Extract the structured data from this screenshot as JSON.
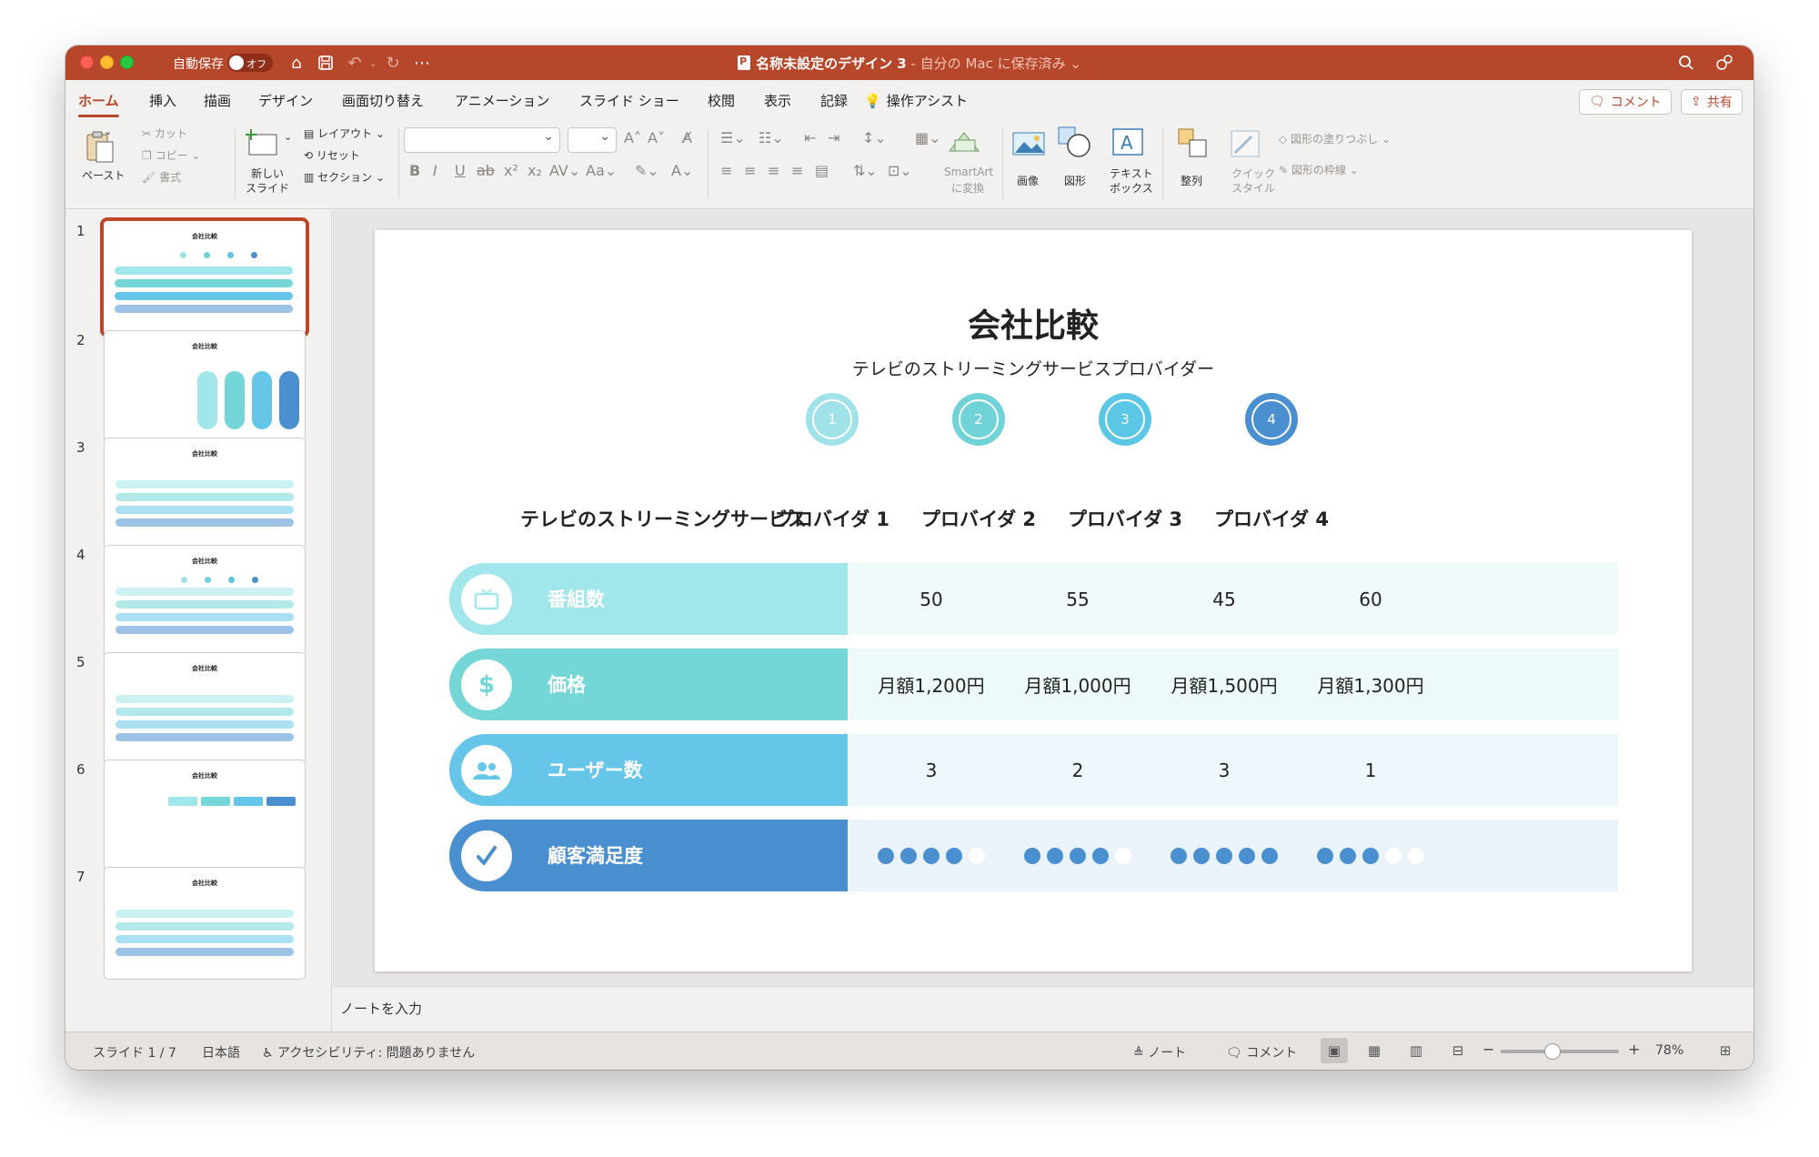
{
  "titlebar": {
    "autosave_label": "自動保存",
    "autosave_state": "オフ",
    "doc_title": "名称未設定のデザイン 3",
    "save_status": " - 自分の Mac に保存済み ⌄"
  },
  "tabs": [
    "ホーム",
    "挿入",
    "描画",
    "デザイン",
    "画面切り替え",
    "アニメーション",
    "スライド ショー",
    "校閲",
    "表示",
    "記録"
  ],
  "assist_label": "操作アシスト",
  "comment_button": "コメント",
  "share_button": "共有",
  "ribbon": {
    "paste": "ペースト",
    "cut": "カット",
    "copy": "コピー",
    "format": "書式",
    "new_slide_1": "新しい",
    "new_slide_2": "スライド",
    "layout": "レイアウト",
    "reset": "リセット",
    "section": "セクション",
    "smartart_1": "SmartArt",
    "smartart_2": "に変換",
    "picture": "画像",
    "shapes": "図形",
    "textbox_1": "テキスト",
    "textbox_2": "ボックス",
    "arrange": "整列",
    "quick_style_1": "クイック",
    "quick_style_2": "スタイル",
    "shape_fill": "図形の塗りつぶし",
    "shape_outline": "図形の枠線"
  },
  "thumbnails": {
    "numbers": [
      "1",
      "2",
      "3",
      "4",
      "5",
      "6",
      "7"
    ],
    "mini_title": "会社比較"
  },
  "slide": {
    "title": "会社比較",
    "subtitle": "テレビのストリーミングサービスプロバイダー",
    "row_header": "テレビのストリーミングサービス",
    "providers": [
      "プロバイダ 1",
      "プロバイダ 2",
      "プロバイダ 3",
      "プロバイダ 4"
    ],
    "provider_numbers": [
      "1",
      "2",
      "3",
      "4"
    ],
    "rows": [
      {
        "label": "番組数",
        "icon": "tv-icon",
        "values": [
          "50",
          "55",
          "45",
          "60"
        ]
      },
      {
        "label": "価格",
        "icon": "dollar-icon",
        "values": [
          "月額1,200円",
          "月額1,000円",
          "月額1,500円",
          "月額1,300円"
        ]
      },
      {
        "label": "ユーザー数",
        "icon": "users-icon",
        "values": [
          "3",
          "2",
          "3",
          "1"
        ]
      },
      {
        "label": "顧客満足度",
        "icon": "check-icon",
        "ratings": [
          4,
          4,
          5,
          3
        ],
        "rating_max": 5
      }
    ],
    "colors": {
      "provider_1": "#9fe3e8",
      "provider_2": "#6fd3d8",
      "provider_3": "#5cc7e5",
      "provider_4": "#4a8fd0",
      "row_1": "#a1e6ea",
      "row_2": "#74d6d6",
      "row_3": "#66c6ea",
      "row_4": "#4a8fd0"
    }
  },
  "notes_placeholder": "ノートを入力",
  "status": {
    "slide_counter": "スライド 1 / 7",
    "language": "日本語",
    "accessibility": "アクセシビリティ: 問題ありません",
    "notes": "ノート",
    "comments": "コメント",
    "zoom": "78%"
  }
}
